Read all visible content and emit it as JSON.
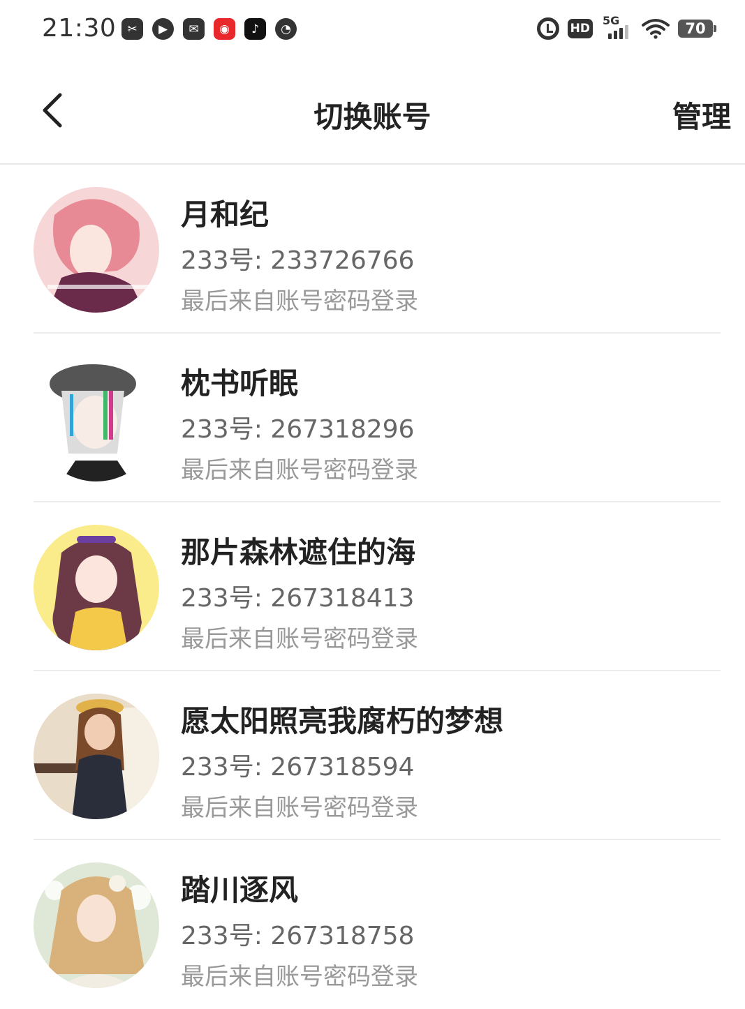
{
  "status_bar": {
    "time": "21:30",
    "apps": [
      {
        "icon": "scissors-app-icon",
        "glyph": "✂",
        "color": "#333333"
      },
      {
        "icon": "play-app-icon",
        "glyph": "▶",
        "color": "#333333"
      },
      {
        "icon": "mail-app-icon",
        "glyph": "✉",
        "color": "#333333"
      },
      {
        "icon": "kuaishou-app-icon",
        "glyph": "◉",
        "color": "#e8282a"
      },
      {
        "icon": "tiktok-app-icon",
        "glyph": "♪",
        "color": "#111111"
      },
      {
        "icon": "speedometer-app-icon",
        "glyph": "◔",
        "color": "#333333"
      }
    ],
    "hd_label": "HD",
    "network_label": "5G",
    "battery_level": "70"
  },
  "header": {
    "title": "切换账号",
    "manage_label": "管理",
    "back_icon": "chevron-left-icon"
  },
  "accounts": [
    {
      "name": "月和纪",
      "id_label": "233号:",
      "id_value": "233726766",
      "login_method": "最后来自账号密码登录",
      "avatar_colors": [
        "#f6d6d6",
        "#e88a96",
        "#6a2a4a"
      ]
    },
    {
      "name": "枕书听眠",
      "id_label": "233号:",
      "id_value": "267318296",
      "login_method": "最后来自账号密码登录",
      "avatar_colors": [
        "#ffffff",
        "#555555",
        "#dcdcdc"
      ]
    },
    {
      "name": "那片森林遮住的海",
      "id_label": "233号:",
      "id_value": "267318413",
      "login_method": "最后来自账号密码登录",
      "avatar_colors": [
        "#faec8a",
        "#6b3a46",
        "#f4c94a"
      ]
    },
    {
      "name": "愿太阳照亮我腐朽的梦想",
      "id_label": "233号:",
      "id_value": "267318594",
      "login_method": "最后来自账号密码登录",
      "avatar_colors": [
        "#e9dcc8",
        "#7a4a2a",
        "#2a2d3a"
      ]
    },
    {
      "name": "踏川逐风",
      "id_label": "233号:",
      "id_value": "267318758",
      "login_method": "最后来自账号密码登录",
      "avatar_colors": [
        "#dfe8d6",
        "#d8b27a",
        "#f2ede2"
      ]
    }
  ]
}
